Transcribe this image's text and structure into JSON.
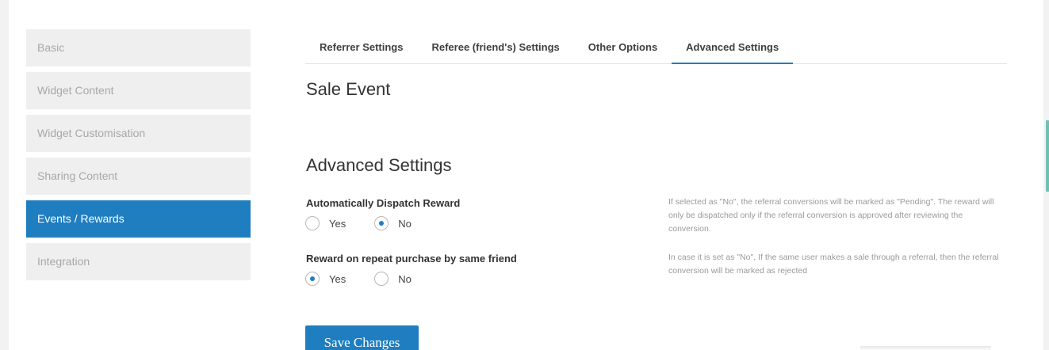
{
  "sidebar": {
    "items": [
      {
        "label": "Basic"
      },
      {
        "label": "Widget Content"
      },
      {
        "label": "Widget Customisation"
      },
      {
        "label": "Sharing Content"
      },
      {
        "label": "Events / Rewards"
      },
      {
        "label": "Integration"
      }
    ],
    "active_index": 4
  },
  "tabs": [
    {
      "label": "Referrer Settings"
    },
    {
      "label": "Referee (friend's) Settings"
    },
    {
      "label": "Other Options"
    },
    {
      "label": "Advanced Settings"
    }
  ],
  "main": {
    "sale_event_title": "Sale Event",
    "advanced_title": "Advanced Settings",
    "dispatch": {
      "label": "Automatically Dispatch Reward",
      "yes": "Yes",
      "no": "No",
      "selected": "No",
      "help": "If selected as \"No\", the referral conversions will be marked as \"Pending\". The reward will only be dispatched only if the referral conversion is approved after reviewing the conversion."
    },
    "repeat": {
      "label": "Reward on repeat purchase by same friend",
      "yes": "Yes",
      "no": "No",
      "selected": "Yes",
      "help": "In case it is set as \"No\", If the same user makes a sale through a referral, then the referral conversion will be marked as rejected"
    },
    "save_label": "Save Changes"
  },
  "colors": {
    "accent": "#1f7ec0",
    "sidebar_bg": "#efefef",
    "sidebar_text": "#a8a8a8"
  }
}
